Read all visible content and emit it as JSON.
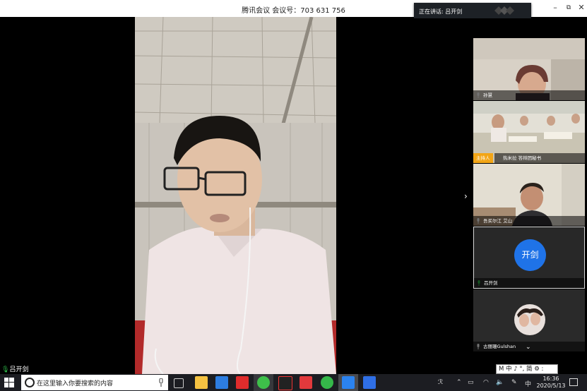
{
  "window": {
    "title": "腾讯会议 会议号：703 631 756",
    "speaking_label": "正在讲话: 吕开剑"
  },
  "participants": [
    {
      "name": "孙慧",
      "role": ""
    },
    {
      "name": "热米拉 答辩团秘书",
      "role": "主持人"
    },
    {
      "name": "吾买尔江 艾山",
      "role": ""
    },
    {
      "name": "吕开剑",
      "avatar_text": "开剑"
    },
    {
      "name": "古丽珊Gulshan",
      "role": ""
    }
  ],
  "main_speaker_name": "吕开剑",
  "ime_text": "M 中 ♪ °, 简 ⚙ :",
  "taskbar": {
    "search_placeholder": "在这里输入你要搜索的内容",
    "time": "16:36",
    "date": "2020/5/13",
    "tray_ime": "中",
    "tray_more": "⌃",
    "tray_person": "ℛ"
  },
  "colors": {
    "accent": "#1f73e8",
    "host_badge": "#f2a516",
    "mic_green": "#2fbf4a"
  }
}
